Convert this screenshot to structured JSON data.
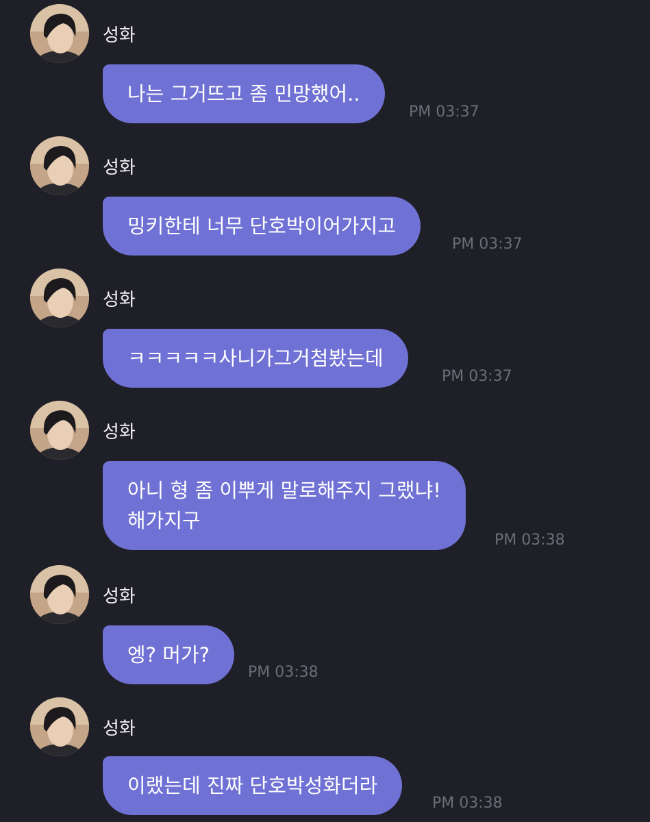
{
  "messages": [
    {
      "sender": "성화",
      "lines": [
        "나는 그거뜨고 좀 민망했어.."
      ],
      "time": "PM 03:37"
    },
    {
      "sender": "성화",
      "lines": [
        "밍키한테 너무 단호박이어가지고"
      ],
      "time": "PM 03:37"
    },
    {
      "sender": "성화",
      "lines": [
        "ㅋㅋㅋㅋㅋ사니가그거첨봤는데"
      ],
      "time": "PM 03:37"
    },
    {
      "sender": "성화",
      "lines": [
        "아니 형 좀 이뿌게 말로해주지 그랬냐!",
        "해가지구"
      ],
      "time": "PM 03:38"
    },
    {
      "sender": "성화",
      "lines": [
        "엥? 머가?"
      ],
      "time": "PM 03:38"
    },
    {
      "sender": "성화",
      "lines": [
        "이랬는데 진짜 단호박성화더라"
      ],
      "time": "PM 03:38"
    }
  ],
  "icons": {
    "avatar": "profile-photo"
  },
  "colors": {
    "background": "#1f1f27",
    "bubble": "#7071d4",
    "bubble_text": "#ffffff",
    "sender_text": "#f2f2f5",
    "time_text": "#6d6d78"
  }
}
